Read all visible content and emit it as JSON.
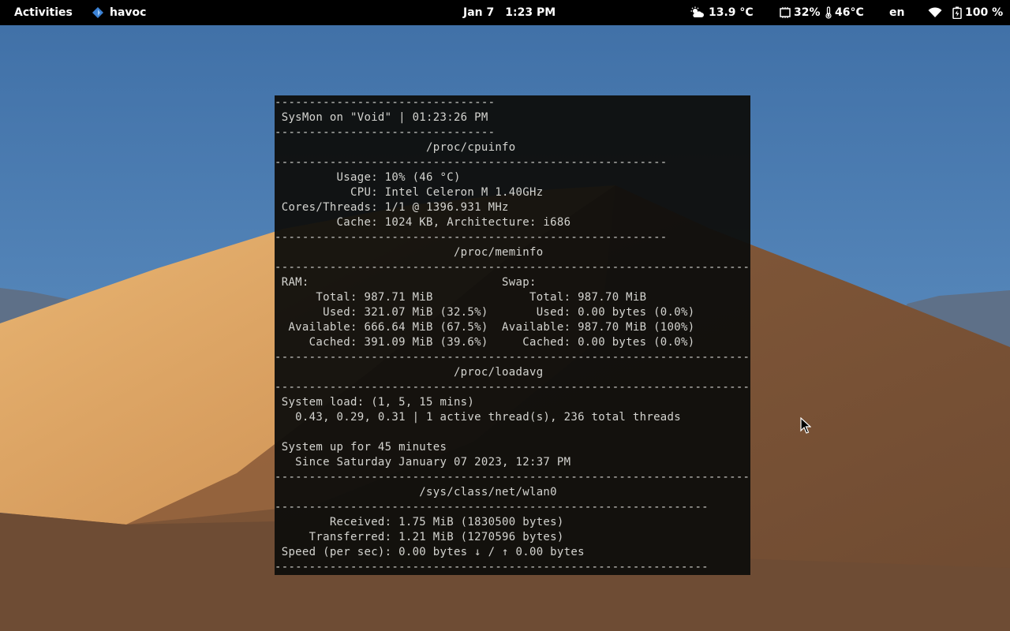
{
  "topbar": {
    "activities": "Activities",
    "app_name": "havoc",
    "date": "Jan 7",
    "time": "1:23 PM",
    "weather": "13.9 °C",
    "cpu_load": "32%",
    "cpu_temp": "46°C",
    "keyboard_layout": "en",
    "battery": "100 %",
    "icons": [
      "havoc-app-icon",
      "weather-partly-cloudy-icon",
      "cpu-icon",
      "thermometer-icon",
      "wifi-icon",
      "battery-charging-icon"
    ]
  },
  "terminal": {
    "lines": [
      "--------------------------------",
      " SysMon on \"Void\" | 01:23:26 PM",
      "--------------------------------",
      "                      /proc/cpuinfo",
      "---------------------------------------------------------",
      "         Usage: 10% (46 °C)",
      "           CPU: Intel Celeron M 1.40GHz",
      " Cores/Threads: 1/1 @ 1396.931 MHz",
      "         Cache: 1024 KB, Architecture: i686",
      "---------------------------------------------------------",
      "                          /proc/meminfo",
      "---------------------------------------------------------------------",
      " RAM:                            Swap:",
      "      Total: 987.71 MiB              Total: 987.70 MiB",
      "       Used: 321.07 MiB (32.5%)       Used: 0.00 bytes (0.0%)",
      "  Available: 666.64 MiB (67.5%)  Available: 987.70 MiB (100%)",
      "     Cached: 391.09 MiB (39.6%)     Cached: 0.00 bytes (0.0%)",
      "---------------------------------------------------------------------",
      "                          /proc/loadavg",
      "---------------------------------------------------------------------",
      " System load: (1, 5, 15 mins)",
      "   0.43, 0.29, 0.31 | 1 active thread(s), 236 total threads",
      "",
      " System up for 45 minutes",
      "   Since Saturday January 07 2023, 12:37 PM",
      "---------------------------------------------------------------------",
      "                     /sys/class/net/wlan0",
      "---------------------------------------------------------------",
      "        Received: 1.75 MiB (1830500 bytes)",
      "     Transferred: 1.21 MiB (1270596 bytes)",
      " Speed (per sec): 0.00 bytes ↓ / ↑ 0.00 bytes",
      "---------------------------------------------------------------"
    ]
  },
  "colors": {
    "sky": "#4a7ab0",
    "dune_light": "#e2a866",
    "dune_shadow": "#6b4a32",
    "topbar": "#000000",
    "terminal_bg": "#0e0e0c",
    "terminal_fg": "#d4d4d0"
  }
}
